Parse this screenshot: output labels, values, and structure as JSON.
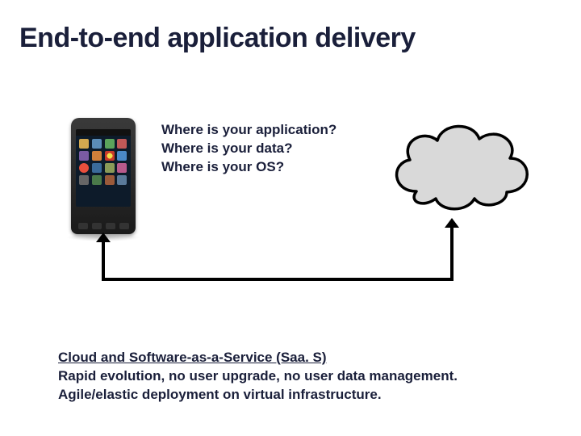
{
  "title": "End-to-end application delivery",
  "questions": {
    "q1": "Where is your application?",
    "q2": "Where is your data?",
    "q3": "Where is your OS?"
  },
  "footer": {
    "heading": "Cloud and Software-as-a-Service (Saa. S)",
    "line1": "Rapid evolution, no user upgrade, no user data management.",
    "line2": "Agile/elastic deployment on virtual infrastructure."
  },
  "icons": {
    "phone": "smartphone-icon",
    "cloud": "cloud-icon"
  },
  "colors": {
    "text": "#1a1f3a",
    "cloud_fill": "#d9d9d9",
    "connector": "#000000"
  }
}
